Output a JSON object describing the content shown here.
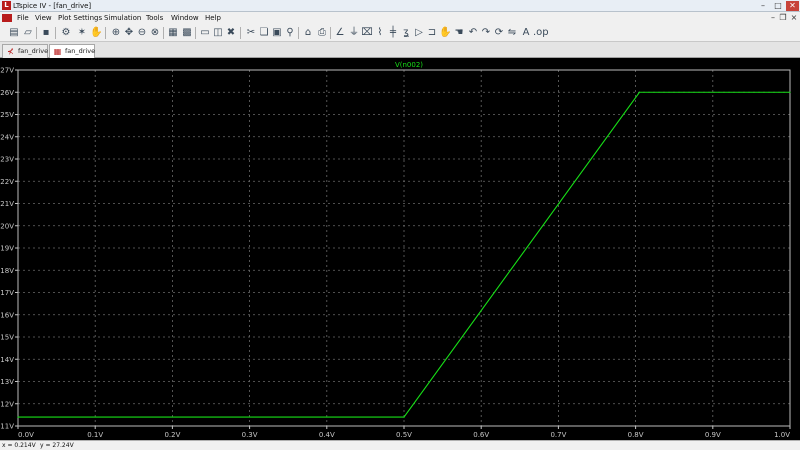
{
  "window": {
    "title": "LTspice IV - [fan_drive]",
    "controls": [
      "–",
      "□",
      "✕"
    ]
  },
  "menu": [
    "File",
    "View",
    "Plot Settings",
    "Simulation",
    "Tools",
    "Window",
    "Help"
  ],
  "tabs": [
    {
      "label": "fan_drive",
      "icon": "schematic-icon",
      "active": false
    },
    {
      "label": "fan_drive",
      "icon": "waveform-icon",
      "active": true
    }
  ],
  "status": {
    "x": "x = 0.214V",
    "y": "y = 27.24V"
  },
  "colors": {
    "trace": "#17e017",
    "grid": "#6a6a6a",
    "axis_text": "#c8c8c8",
    "background": "#000000"
  },
  "chart_data": {
    "type": "line",
    "title": "V(n002)",
    "xlim": [
      0,
      1
    ],
    "ylim": [
      11,
      27
    ],
    "x_ticks": [
      "0.0V",
      "0.1V",
      "0.2V",
      "0.3V",
      "0.4V",
      "0.5V",
      "0.6V",
      "0.7V",
      "0.8V",
      "0.9V",
      "1.0V"
    ],
    "y_ticks": [
      "27V",
      "26V",
      "25V",
      "24V",
      "23V",
      "22V",
      "21V",
      "20V",
      "19V",
      "18V",
      "17V",
      "16V",
      "15V",
      "14V",
      "13V",
      "12V",
      "11V"
    ],
    "grid": true,
    "series": [
      {
        "name": "V(n002)",
        "x": [
          0,
          0.5,
          0.805,
          1.0
        ],
        "y": [
          11.4,
          11.4,
          26.0,
          26.0
        ]
      }
    ]
  }
}
